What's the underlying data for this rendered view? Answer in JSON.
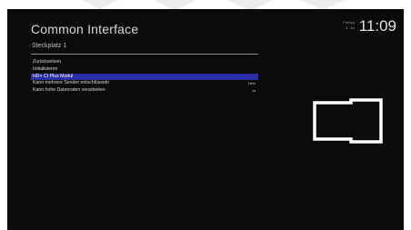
{
  "header": {
    "title": "Common Interface"
  },
  "clock": {
    "weekday": "Freitag",
    "date": "4. Jul",
    "time": "11:09"
  },
  "subtitle": "Steckplatz 1",
  "menu": {
    "items": [
      {
        "label": "Zurücksetzen",
        "value": ""
      },
      {
        "label": "Initialisieren",
        "value": ""
      },
      {
        "label": "HD+ CI Plus Modul",
        "value": ""
      },
      {
        "label": "Kann mehrere Sender entschlüsseln",
        "value": "Nein"
      },
      {
        "label": "Kann hohe Datenraten verarbeiten",
        "value": "Ja"
      }
    ],
    "selected_index": 2
  },
  "icons": {
    "module": "ci-module-icon"
  },
  "colors": {
    "screen_bg": "#0b0b0b",
    "selection": "#2a2fa4",
    "text": "#d5d5d5"
  }
}
